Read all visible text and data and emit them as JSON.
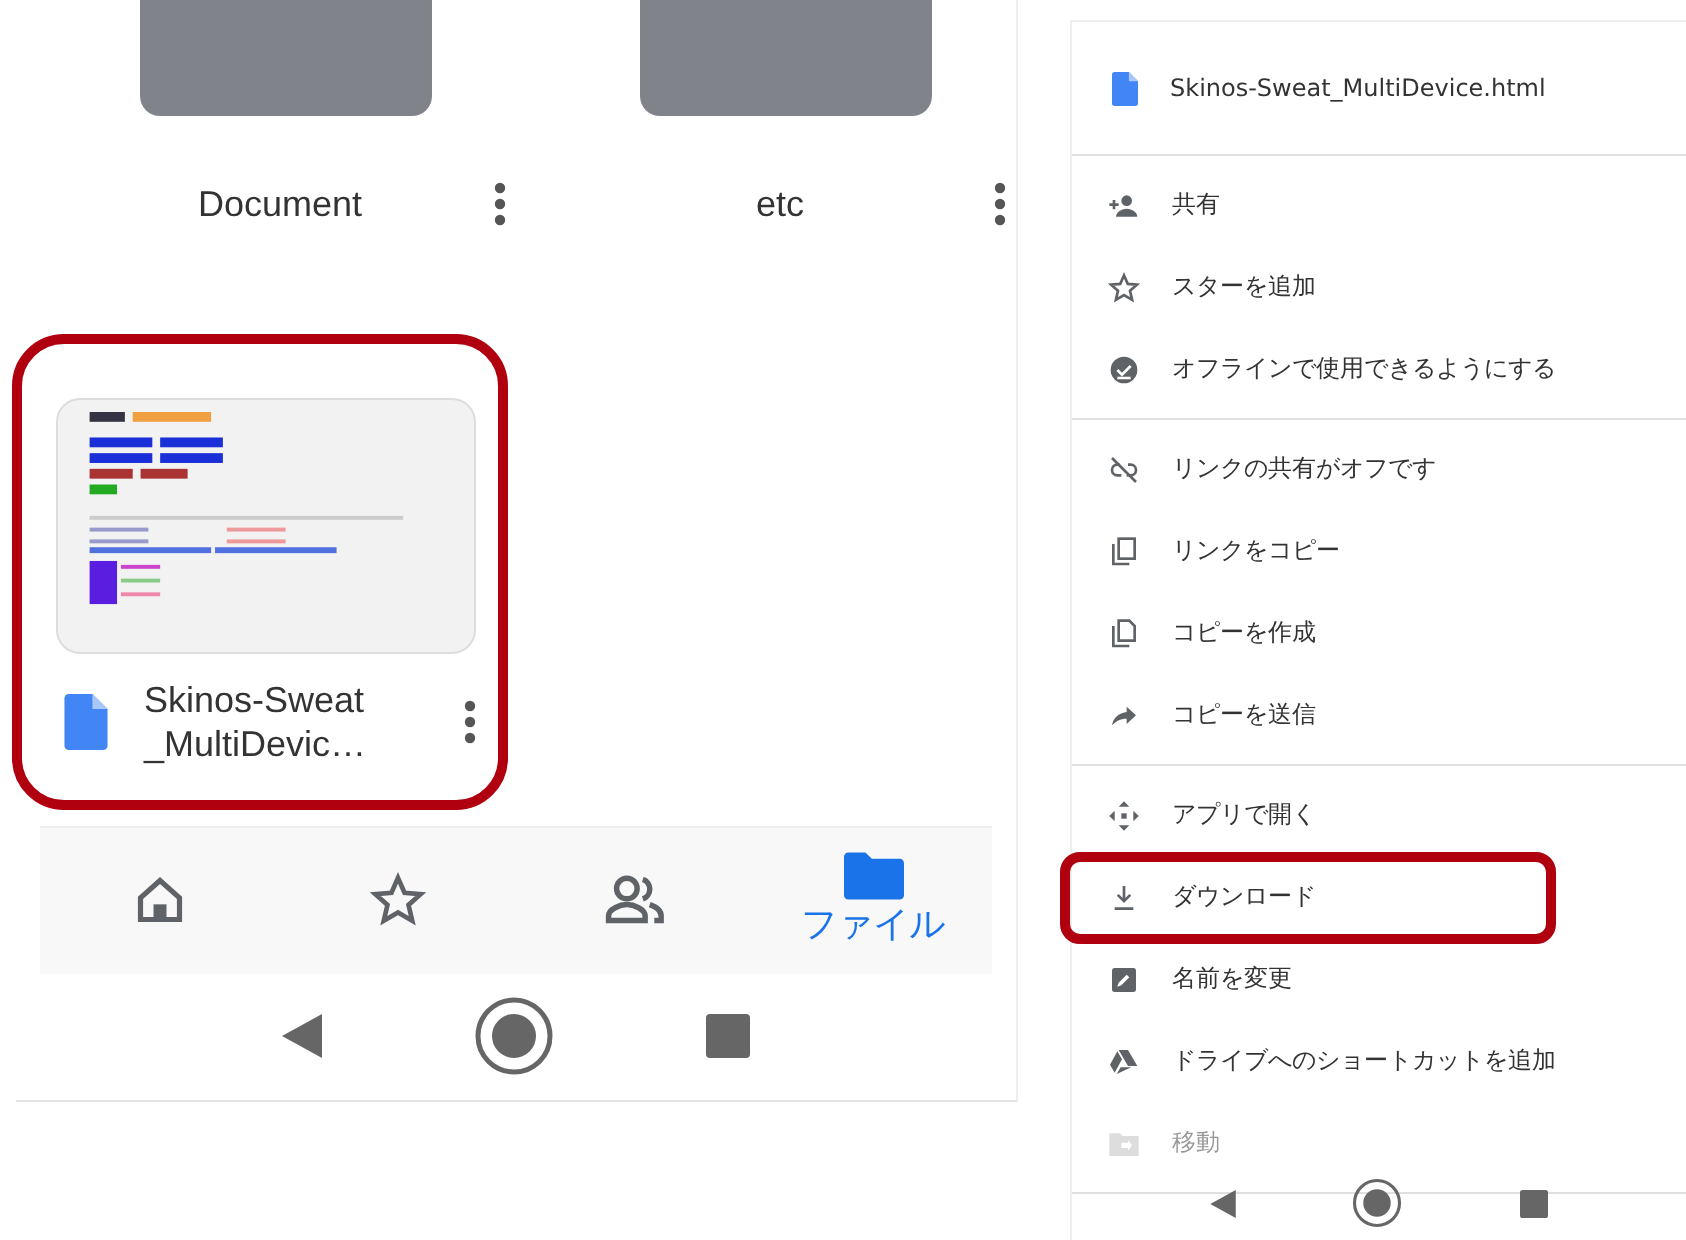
{
  "left": {
    "folders": [
      {
        "name": "Document"
      },
      {
        "name": "etc"
      }
    ],
    "file": {
      "name_lines": [
        "Skinos-Sweat",
        "_MultiDevic…"
      ],
      "highlighted": true
    },
    "bottom_nav": [
      {
        "kind": "home",
        "selected": false
      },
      {
        "kind": "star",
        "selected": false
      },
      {
        "kind": "people",
        "selected": false
      },
      {
        "kind": "folder",
        "selected": true,
        "label": "ファイル"
      }
    ]
  },
  "right": {
    "header": {
      "title": "Skinos-Sweat_MultiDevice.html"
    },
    "sections": [
      [
        {
          "kind": "person-add",
          "label": "共有",
          "disabled": false,
          "highlighted": false
        },
        {
          "kind": "star",
          "label": "スターを追加",
          "disabled": false,
          "highlighted": false
        },
        {
          "kind": "offline",
          "label": "オフラインで使用できるようにする",
          "disabled": false,
          "highlighted": false
        }
      ],
      [
        {
          "kind": "link-off",
          "label": "リンクの共有がオフです",
          "disabled": false,
          "highlighted": false
        },
        {
          "kind": "copy",
          "label": "リンクをコピー",
          "disabled": false,
          "highlighted": false
        },
        {
          "kind": "file-copy",
          "label": "コピーを作成",
          "disabled": false,
          "highlighted": false
        },
        {
          "kind": "send",
          "label": "コピーを送信",
          "disabled": false,
          "highlighted": false
        }
      ],
      [
        {
          "kind": "move",
          "label": "アプリで開く",
          "disabled": false,
          "highlighted": false
        },
        {
          "kind": "download",
          "label": "ダウンロード",
          "disabled": false,
          "highlighted": true
        },
        {
          "kind": "edit",
          "label": "名前を変更",
          "disabled": false,
          "highlighted": false
        },
        {
          "kind": "drive-add",
          "label": "ドライブへのショートカットを追加",
          "disabled": false,
          "highlighted": false
        },
        {
          "kind": "folder-move",
          "label": "移動",
          "disabled": true,
          "highlighted": false
        }
      ]
    ]
  }
}
